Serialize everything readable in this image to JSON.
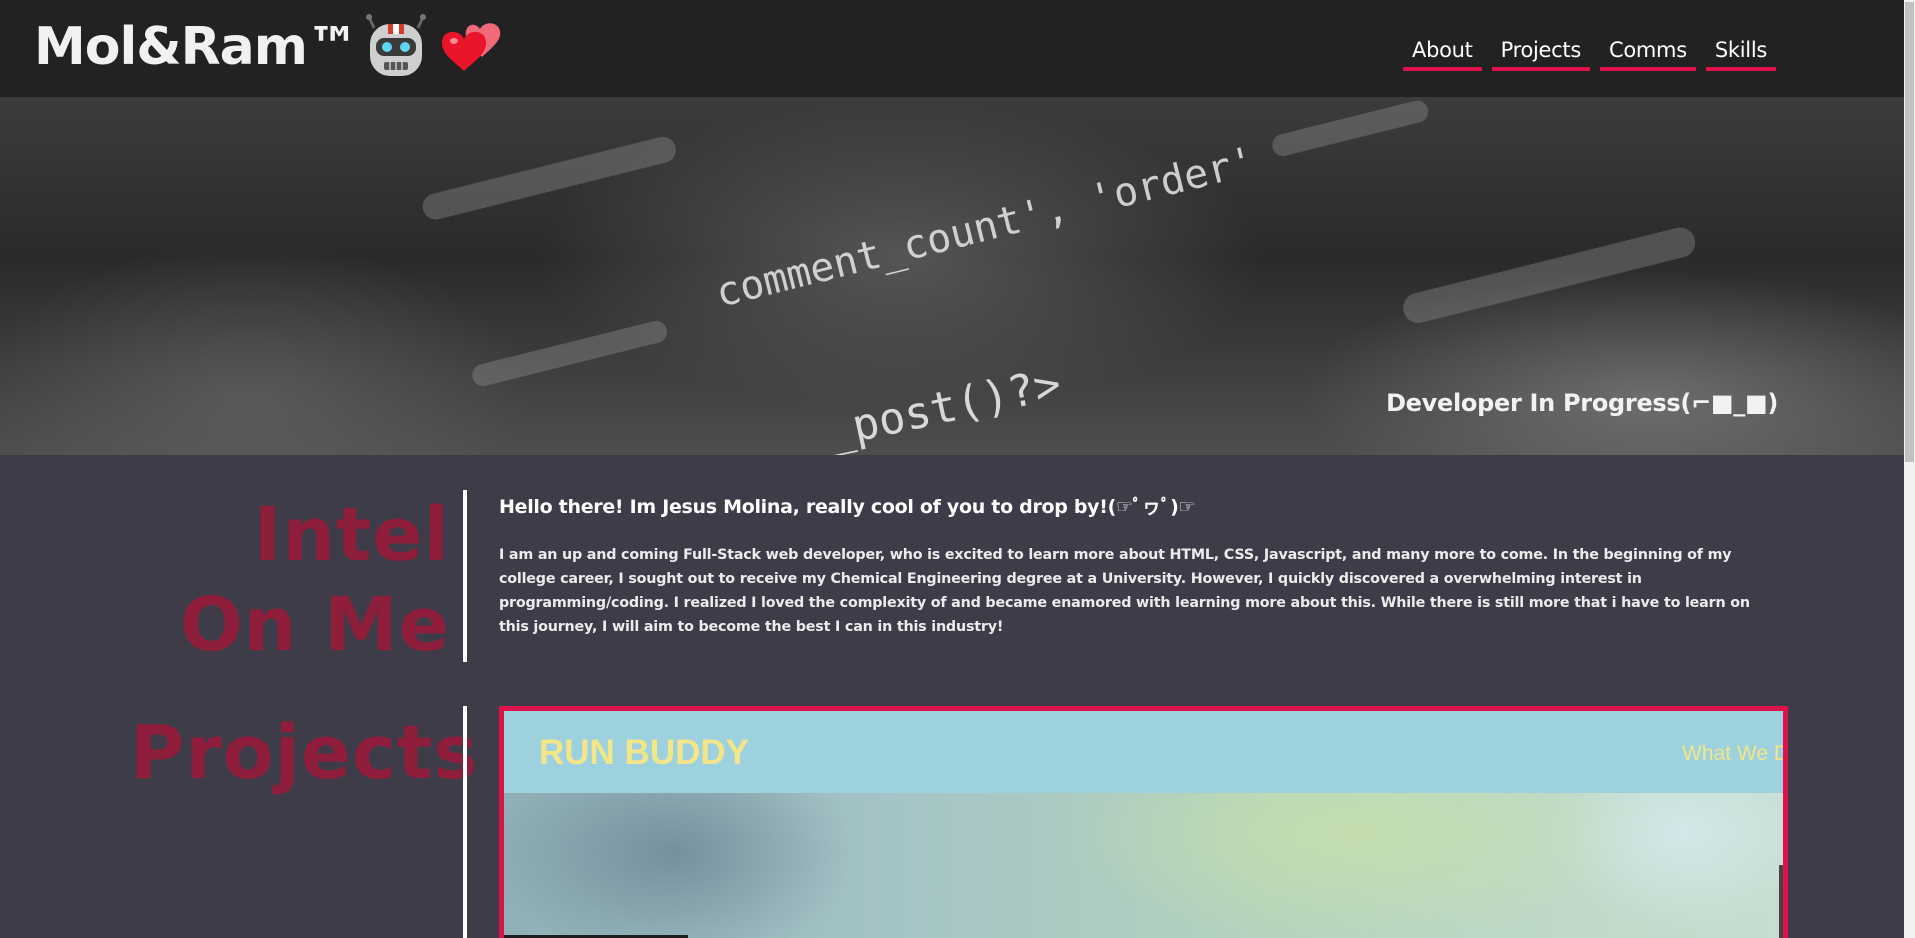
{
  "header": {
    "brand": "Mol&Ram™",
    "nav": [
      {
        "label": "About"
      },
      {
        "label": "Projects"
      },
      {
        "label": "Comms"
      },
      {
        "label": "Skills"
      }
    ]
  },
  "hero": {
    "code_line_1": "comment_count', 'order'",
    "code_line_2": "_post()?>",
    "tagline": "Developer In Progress(⌐■_■)"
  },
  "about": {
    "title": "Intel On Me",
    "heading": "Hello there! Im Jesus Molina, really cool of you to drop by!(☞ﾟヮﾟ)☞",
    "body": "I am an up and coming Full-Stack web developer, who is excited to learn more about HTML, CSS, Javascript, and many more to come. In the beginning of my college career, I sought out to receive my Chemical Engineering degree at a University. However, I quickly discovered a overwhelming interest in programming/coding. I realized I loved the complexity of and became enamored with learning more about this. While there is still more that i have to learn on this journey, I will aim to become the best I can in this industry!"
  },
  "projects": {
    "title": "Projects",
    "items": [
      {
        "logo": "RUN BUDDY",
        "nav_text": "What We D"
      }
    ]
  },
  "icons": {
    "robot": "robot-icon",
    "heart": "two-hearts-icon"
  },
  "colors": {
    "accent": "#e0124c",
    "section_title": "#8f1d3c",
    "header_bg": "#222222",
    "page_bg": "#3d3c48"
  }
}
